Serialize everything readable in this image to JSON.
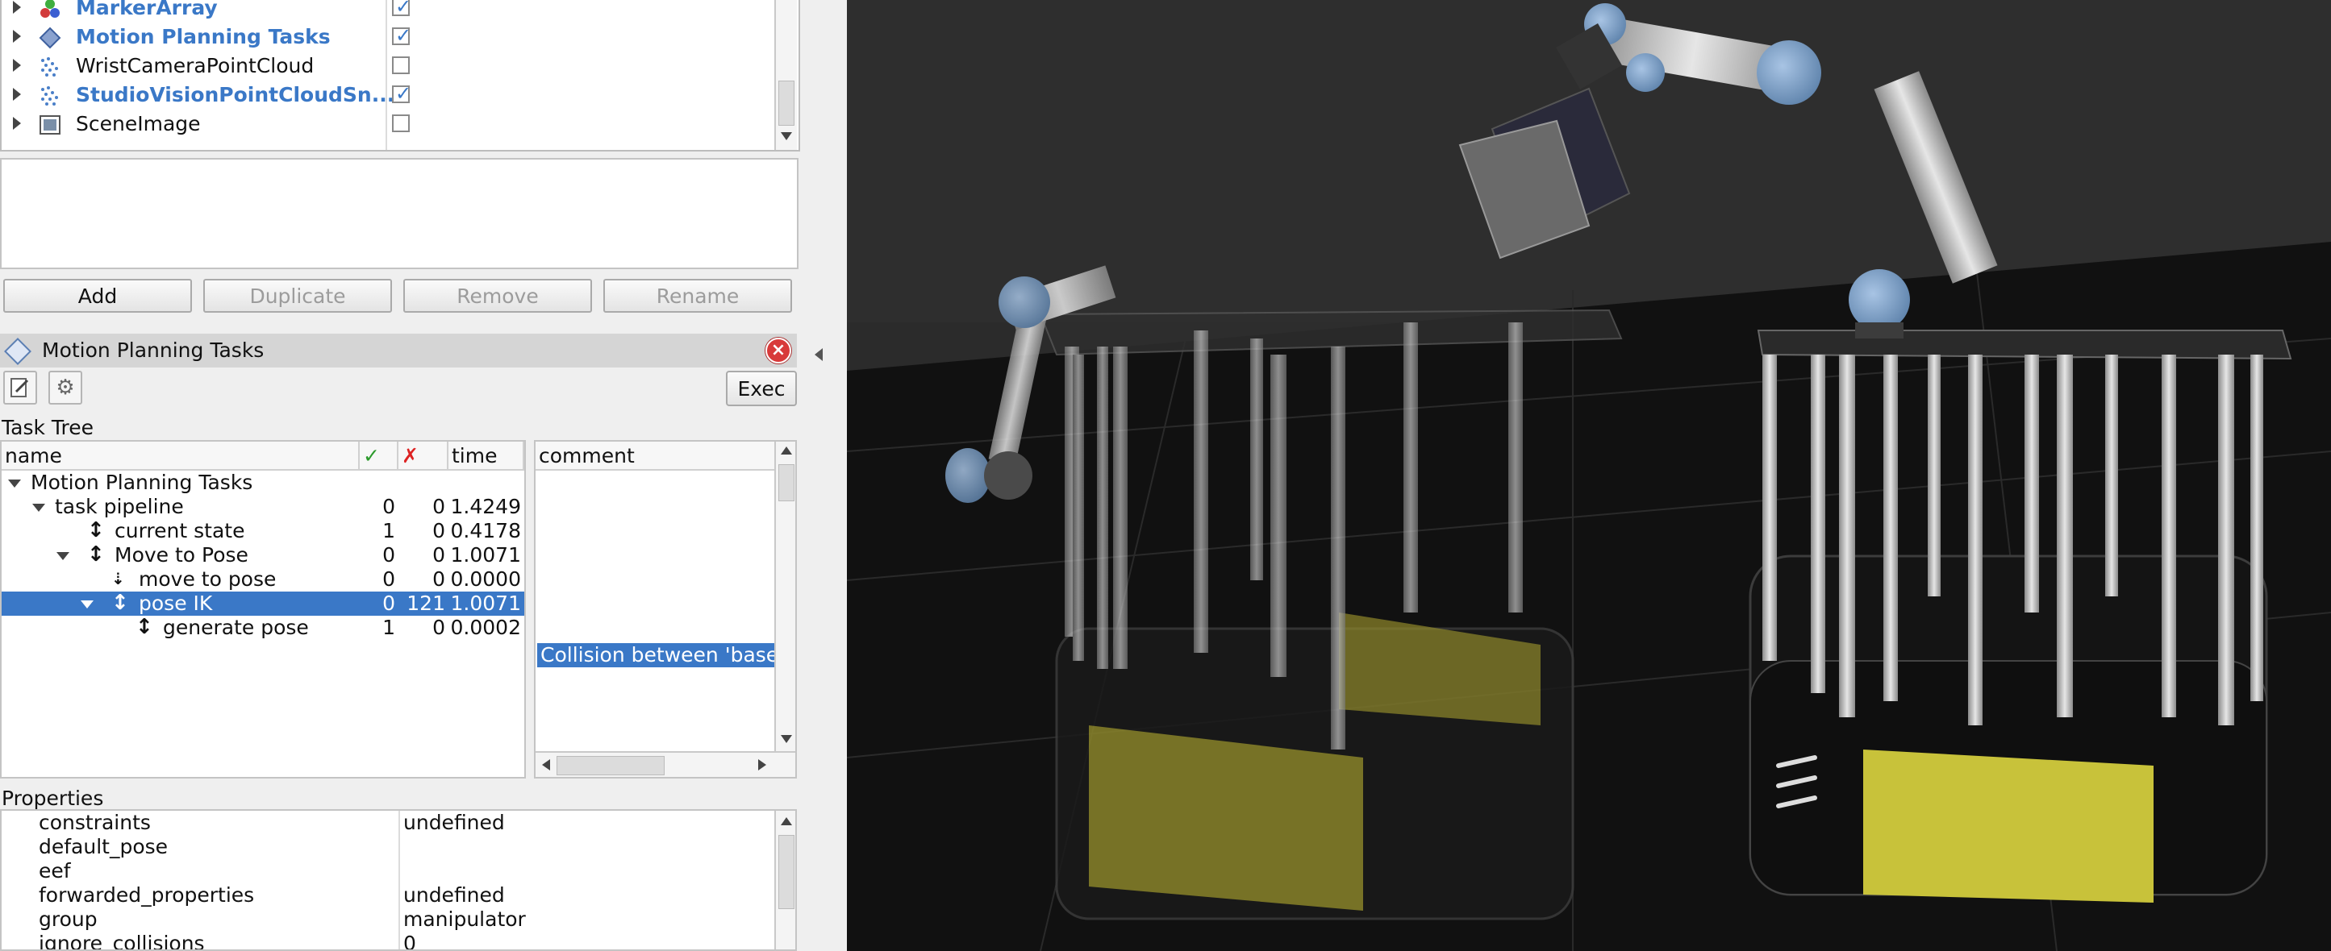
{
  "colors": {
    "accent": "#3a78c7",
    "selection": "#3a78c7",
    "viewport_bg": "#2b2b2b",
    "robot_base_yellow": "#c8c23a",
    "close_red": "#d83a3a"
  },
  "displays": {
    "items": [
      {
        "label": "MarkerArray",
        "bold": true,
        "checked": true,
        "icon": "marker-array-icon"
      },
      {
        "label": "Motion Planning Tasks",
        "bold": true,
        "checked": true,
        "icon": "motion-planning-icon"
      },
      {
        "label": "WristCameraPointCloud",
        "bold": false,
        "checked": false,
        "icon": "pointcloud-icon"
      },
      {
        "label": "StudioVisionPointCloudSn...",
        "bold": true,
        "checked": true,
        "icon": "pointcloud-icon"
      },
      {
        "label": "SceneImage",
        "bold": false,
        "checked": false,
        "icon": "image-icon"
      }
    ]
  },
  "buttons": {
    "add": "Add",
    "duplicate": "Duplicate",
    "remove": "Remove",
    "rename": "Rename"
  },
  "panel": {
    "title": "Motion Planning Tasks",
    "exec": "Exec",
    "task_tree_label": "Task Tree"
  },
  "tree": {
    "headers": {
      "name": "name",
      "success": "✓",
      "fail": "✗",
      "time": "time"
    },
    "rows": [
      {
        "name": "Motion Planning Tasks",
        "success": "",
        "fail": "",
        "time": ""
      },
      {
        "name": "task pipeline",
        "success": "0",
        "fail": "0",
        "time": "1.4249"
      },
      {
        "name": "current state",
        "success": "1",
        "fail": "0",
        "time": "0.4178"
      },
      {
        "name": "Move to Pose",
        "success": "0",
        "fail": "0",
        "time": "1.0071"
      },
      {
        "name": "move to pose",
        "success": "0",
        "fail": "0",
        "time": "0.0000"
      },
      {
        "name": "pose IK",
        "success": "0",
        "fail": "121",
        "time": "1.0071"
      },
      {
        "name": "generate pose",
        "success": "1",
        "fail": "0",
        "time": "0.0002"
      }
    ]
  },
  "comment": {
    "header": "comment",
    "selected": "Collision between 'base"
  },
  "properties": {
    "label": "Properties",
    "rows": [
      {
        "name": "constraints",
        "value": "undefined"
      },
      {
        "name": "default_pose",
        "value": ""
      },
      {
        "name": "eef",
        "value": ""
      },
      {
        "name": "forwarded_properties",
        "value": "undefined"
      },
      {
        "name": "group",
        "value": "manipulator"
      },
      {
        "name": "ignore_collisions",
        "value": "0"
      }
    ]
  }
}
